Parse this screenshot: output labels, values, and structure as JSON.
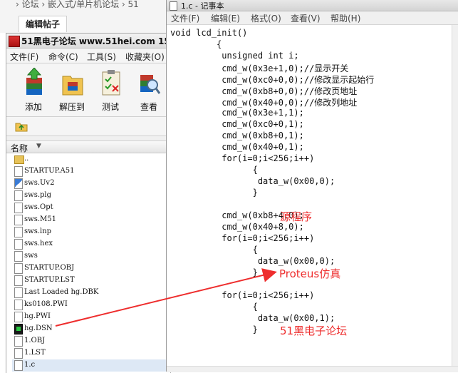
{
  "background_page": {
    "breadcrumb": "› 论坛 › 嵌入式/单片机论坛 › 51",
    "edit_tab": "编辑帖子"
  },
  "left_window": {
    "title": "51黑电子论坛 www.51hei.com 15",
    "menu": [
      "文件(F)",
      "命令(C)",
      "工具(S)",
      "收藏夹(O)"
    ],
    "toolbar": [
      {
        "label": "添加",
        "icon": "add-archive-icon"
      },
      {
        "label": "解压到",
        "icon": "extract-folder-icon"
      },
      {
        "label": "测试",
        "icon": "test-clipboard-icon"
      },
      {
        "label": "查看",
        "icon": "view-magnifier-icon"
      }
    ],
    "list_header": "名称",
    "files": [
      {
        "name": "..",
        "icon": "folder-up-icon"
      },
      {
        "name": "STARTUP.A51",
        "icon": "file-icon"
      },
      {
        "name": "sws.Uv2",
        "icon": "uvision-file-icon"
      },
      {
        "name": "sws.plg",
        "icon": "file-icon"
      },
      {
        "name": "sws.Opt",
        "icon": "file-icon"
      },
      {
        "name": "sws.M51",
        "icon": "file-icon"
      },
      {
        "name": "sws.lnp",
        "icon": "file-icon"
      },
      {
        "name": "sws.hex",
        "icon": "file-icon"
      },
      {
        "name": "sws",
        "icon": "file-icon"
      },
      {
        "name": "STARTUP.OBJ",
        "icon": "file-icon"
      },
      {
        "name": "STARTUP.LST",
        "icon": "file-icon"
      },
      {
        "name": "Last Loaded hg.DBK",
        "icon": "file-icon"
      },
      {
        "name": "ks0108.PWI",
        "icon": "file-icon"
      },
      {
        "name": "hg.PWI",
        "icon": "file-icon"
      },
      {
        "name": "hg.DSN",
        "icon": "proteus-design-icon"
      },
      {
        "name": "1.OBJ",
        "icon": "file-icon"
      },
      {
        "name": "1.LST",
        "icon": "file-icon"
      },
      {
        "name": "1.c",
        "icon": "file-icon"
      }
    ]
  },
  "notepad": {
    "title": "1.c - 记事本",
    "menu": [
      "文件(F)",
      "编辑(E)",
      "格式(O)",
      "查看(V)",
      "帮助(H)"
    ],
    "code_lines": [
      "void lcd_init()",
      "         {",
      "          unsigned int i;",
      "          cmd_w(0x3e+1,0);//显示开关",
      "          cmd_w(0xc0+0,0);//修改显示起始行",
      "          cmd_w(0xb8+0,0);//修改页地址",
      "          cmd_w(0x40+0,0);//修改列地址",
      "          cmd_w(0x3e+1,1);",
      "          cmd_w(0xc0+0,1);",
      "          cmd_w(0xb8+0,1);",
      "          cmd_w(0x40+0,1);",
      "          for(i=0;i<256;i++)",
      "                {",
      "                 data_w(0x00,0);",
      "                }",
      "",
      "          cmd_w(0xb8+4,0);",
      "          cmd_w(0x40+8,0);",
      "          for(i=0;i<256;i++)",
      "                {",
      "                 data_w(0x00,0);",
      "                }",
      "",
      "          for(i=0;i<256;i++)",
      "                {",
      "                 data_w(0x00,1);",
      "                }"
    ]
  },
  "annotations": {
    "source": "源程序",
    "proteus": "Proteus仿真",
    "forum": "51黑电子论坛",
    "color": "#ee2d2d"
  }
}
